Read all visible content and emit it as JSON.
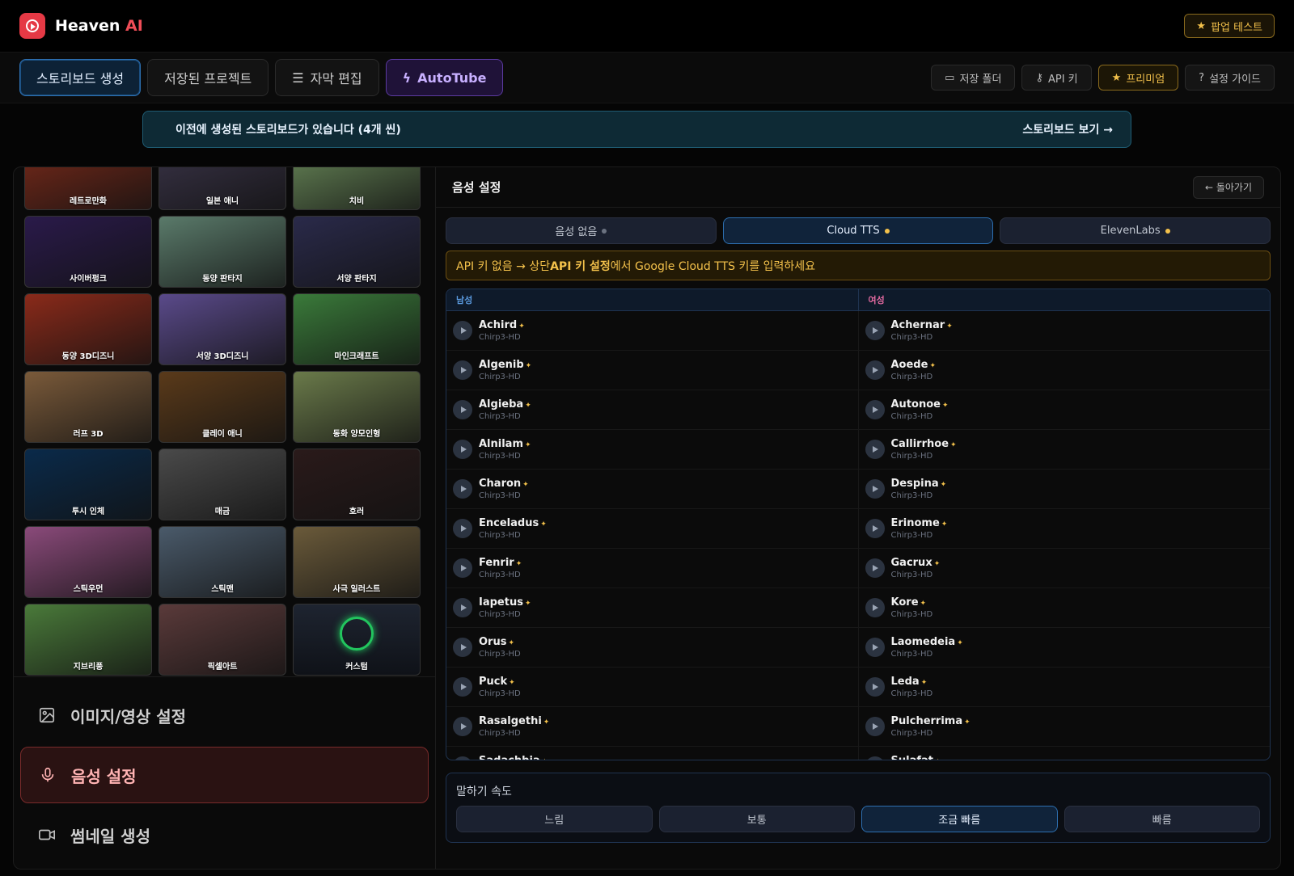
{
  "brand": {
    "name": "Heaven",
    "ai": "AI"
  },
  "popup_test": "팝업 테스트",
  "tabs": [
    {
      "label": "스토리보드 생성"
    },
    {
      "label": "저장된 프로젝트"
    },
    {
      "label": "자막 편집"
    },
    {
      "label": "AutoTube"
    }
  ],
  "toolbar": {
    "folder": "저장 폴더",
    "api_key": "API 키",
    "premium": "프리미엄",
    "guide": "설정 가이드"
  },
  "notice": {
    "text": "이전에 생성된 스토리보드가 있습니다 (4개 씬)",
    "link": "스토리보드 보기 →"
  },
  "styles": [
    {
      "label": "레트로만화",
      "color": "#7a2a1a"
    },
    {
      "label": "일본 애니",
      "color": "#3a3448"
    },
    {
      "label": "치비",
      "color": "#6a8a5a"
    },
    {
      "label": "사이버펑크",
      "color": "#2a1a4a"
    },
    {
      "label": "동양 판타지",
      "color": "#5a7a6a"
    },
    {
      "label": "서양 판타지",
      "color": "#2a2a4a"
    },
    {
      "label": "동양 3D디즈니",
      "color": "#8a2a1a"
    },
    {
      "label": "서양 3D디즈니",
      "color": "#5a4a8a"
    },
    {
      "label": "마인크래프트",
      "color": "#3a7a3a"
    },
    {
      "label": "러프 3D",
      "color": "#7a5a3a"
    },
    {
      "label": "클레이 애니",
      "color": "#5a3a1a"
    },
    {
      "label": "동화 양모인형",
      "color": "#6a7a4a"
    },
    {
      "label": "투시 인체",
      "color": "#0a2a4a"
    },
    {
      "label": "매금",
      "color": "#4a4a4a"
    },
    {
      "label": "호러",
      "color": "#2a1a1a"
    },
    {
      "label": "스틱우먼",
      "color": "#8a4a7a"
    },
    {
      "label": "스틱맨",
      "color": "#4a5a6a"
    },
    {
      "label": "사극 일러스트",
      "color": "#6a5a3a"
    },
    {
      "label": "지브리풍",
      "color": "#4a7a3a"
    },
    {
      "label": "픽셀아트",
      "color": "#5a3a3a"
    },
    {
      "label": "커스텀",
      "color": "custom"
    }
  ],
  "sections": [
    {
      "label": "이미지/영상 설정"
    },
    {
      "label": "음성 설정"
    },
    {
      "label": "썸네일 생성"
    }
  ],
  "voice_panel": {
    "title": "음성 설정",
    "back": "← 돌아가기",
    "engines": [
      {
        "label": "음성 없음",
        "dot": "#6b7280"
      },
      {
        "label": "Cloud TTS",
        "dot": "#f3c14b"
      },
      {
        "label": "ElevenLabs",
        "dot": "#f3c14b"
      }
    ],
    "api_warning": {
      "pre": "API 키 없음 → 상단 ",
      "bold": "API 키 설정",
      "post": "에서 Google Cloud TTS 키를 입력하세요"
    },
    "male_header": "남성",
    "female_header": "여성",
    "star": "✦",
    "voice_model": "Chirp3-HD",
    "male": [
      "Achird",
      "Algenib",
      "Algieba",
      "Alnilam",
      "Charon",
      "Enceladus",
      "Fenrir",
      "Iapetus",
      "Orus",
      "Puck",
      "Rasalgethi",
      "Sadachbia"
    ],
    "female": [
      "Achernar",
      "Aoede",
      "Autonoe",
      "Callirrhoe",
      "Despina",
      "Erinome",
      "Gacrux",
      "Kore",
      "Laomedeia",
      "Leda",
      "Pulcherrima",
      "Sulafat"
    ]
  },
  "speed": {
    "label": "말하기 속도",
    "options": [
      "느림",
      "보통",
      "조금 빠름",
      "빠름"
    ]
  }
}
